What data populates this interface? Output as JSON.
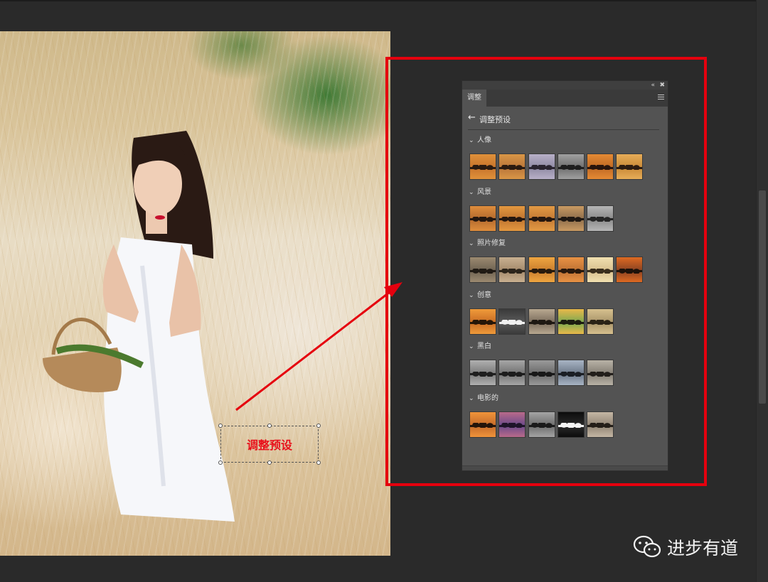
{
  "panel": {
    "tab_label": "调整",
    "header_title": "调整预设",
    "collapse_icon": "double-chevron-left-icon",
    "close_icon": "close-icon",
    "menu_icon": "hamburger-menu-icon",
    "sections": [
      {
        "label": "人像",
        "thumbs": [
          {
            "sky": "#e0913a",
            "water": "#c7742c",
            "tr": "#2a1a10"
          },
          {
            "sky": "#d99646",
            "water": "#b9763a",
            "tr": "#2a1a10"
          },
          {
            "sky": "#b8b0c8",
            "water": "#8f8aa3",
            "tr": "#2a2430"
          },
          {
            "sky": "#a0a0a0",
            "water": "#6e6e6e",
            "tr": "#1e1e1e"
          },
          {
            "sky": "#e58a34",
            "water": "#c06a24",
            "tr": "#2a150c"
          },
          {
            "sky": "#e7ad58",
            "water": "#c98a38",
            "tr": "#2d1c10"
          }
        ]
      },
      {
        "label": "风景",
        "thumbs": [
          {
            "sky": "#df8d3c",
            "water": "#b36a2e",
            "tr": "#24160e"
          },
          {
            "sky": "#e4983f",
            "water": "#bf7430",
            "tr": "#24160e"
          },
          {
            "sky": "#e39a44",
            "water": "#c47a34",
            "tr": "#26170e"
          },
          {
            "sky": "#c99a62",
            "water": "#8e6e4c",
            "tr": "#201812"
          },
          {
            "sky": "#b6b6b6",
            "water": "#8a8a8a",
            "tr": "#262626"
          }
        ]
      },
      {
        "label": "照片修复",
        "thumbs": [
          {
            "sky": "#9c8a70",
            "water": "#6e6252",
            "tr": "#201a14"
          },
          {
            "sky": "#c9b090",
            "water": "#a48a6c",
            "tr": "#2c241a"
          },
          {
            "sky": "#efa540",
            "water": "#c97e2e",
            "tr": "#281a0c"
          },
          {
            "sky": "#e89244",
            "water": "#be7234",
            "tr": "#28180c"
          },
          {
            "sky": "#f1e0b0",
            "water": "#d8c08e",
            "tr": "#3a2e1c"
          },
          {
            "sky": "#de6a22",
            "water": "#8a4222",
            "tr": "#1e120a"
          }
        ]
      },
      {
        "label": "创意",
        "thumbs": [
          {
            "sky": "#ef9a3a",
            "water": "#c86c24",
            "tr": "#261608"
          },
          {
            "sky": "#3a3a3a",
            "water": "#5a5a5a",
            "tr": "#f0f0f0"
          },
          {
            "sky": "#b8a890",
            "water": "#7a6c5c",
            "tr": "#1e1812"
          },
          {
            "sky": "#e9b84a",
            "water": "#7aa850",
            "tr": "#1c1c10"
          },
          {
            "sky": "#d6c08e",
            "water": "#a8946a",
            "tr": "#2a2216"
          }
        ]
      },
      {
        "label": "黑白",
        "thumbs": [
          {
            "sky": "#b0b0b0",
            "water": "#7a7a7a",
            "tr": "#1e1e1e"
          },
          {
            "sky": "#a6a6a6",
            "water": "#727272",
            "tr": "#1c1c1c"
          },
          {
            "sky": "#9a9a9a",
            "water": "#6a6a6a",
            "tr": "#181818"
          },
          {
            "sky": "#a8b4c4",
            "water": "#6c7888",
            "tr": "#1a1e24"
          },
          {
            "sky": "#b8b2a6",
            "water": "#847e74",
            "tr": "#221e1a"
          }
        ]
      },
      {
        "label": "电影的",
        "thumbs": [
          {
            "sky": "#f0943a",
            "water": "#c46a2a",
            "tr": "#24140a"
          },
          {
            "sky": "#b86a8a",
            "water": "#6a4a8a",
            "tr": "#1e142a"
          },
          {
            "sky": "#a4a4a4",
            "water": "#6c6c6c",
            "tr": "#1a1a1a"
          },
          {
            "sky": "#0c0c0c",
            "water": "#2a2a2a",
            "tr": "#f4f4f4"
          },
          {
            "sky": "#c4b6a4",
            "water": "#908474",
            "tr": "#241e18"
          }
        ]
      }
    ]
  },
  "annotation": {
    "label": "调整预设",
    "frame_color": "#e5000e",
    "label_color": "#e8101a"
  },
  "watermark": {
    "icon": "wechat-icon",
    "text": "进步有道"
  }
}
